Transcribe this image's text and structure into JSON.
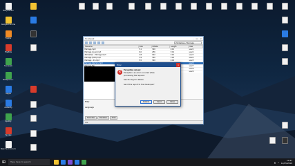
{
  "desktop": {
    "icons_col1": [
      {
        "label": "Recycle Bin",
        "icon": "recycle-bin-icon",
        "color": "#f2f2f2"
      },
      {
        "label": "Google Chrome",
        "icon": "chrome-icon",
        "color": "#f1c232"
      },
      {
        "label": "Firefox",
        "icon": "firefox-icon",
        "color": "#f08a24"
      },
      {
        "label": "FileZilla",
        "icon": "filezilla-icon",
        "color": "#d83b2b"
      },
      {
        "label": "Soulseek",
        "icon": "soulseek-icon",
        "color": "#3fa34d"
      },
      {
        "label": "Notepad++",
        "icon": "notepad-icon",
        "color": "#3fa34d"
      },
      {
        "label": "Skype",
        "icon": "skype-icon",
        "color": "#2a7be4"
      },
      {
        "label": "Audacity",
        "icon": "audacity-icon",
        "color": "#2a7be4"
      },
      {
        "label": "Spotify",
        "icon": "spotify-icon",
        "color": "#3fa34d"
      },
      {
        "label": "Yandex",
        "icon": "yandex-icon",
        "color": "#d83b2b"
      },
      {
        "label": "New Text Document",
        "icon": "document-icon",
        "color": "#f2f2f2"
      }
    ]
  },
  "app": {
    "title": "Soulseek",
    "search_value": "Zimbabwe / Marrage",
    "columns": [
      "Filename",
      "Size",
      "Bitrate",
      "Length",
      "User"
    ],
    "rows": [
      [
        "Marrage.mp3",
        "5.1",
        "320",
        "4:12",
        "user1"
      ],
      [
        "Marrage (Live).mp3",
        "6.0",
        "256",
        "5:01",
        "user2"
      ],
      [
        "Zimbabwe - Marrage.mp3",
        "4.8",
        "192",
        "4:10",
        "user3"
      ],
      [
        "Marrage (Edit).mp3",
        "3.9",
        "320",
        "3:20",
        "user4"
      ],
      [
        "Marrage - 01.mp3",
        "5.5",
        "320",
        "4:40",
        "user5"
      ],
      [
        "Marrage (Remix).mp3",
        "7.2",
        "320",
        "6:01",
        "user6"
      ],
      [
        "Marrage.flac",
        "22.4",
        "1411",
        "4:12",
        "user7"
      ],
      [
        "Marrage (Instr).mp3",
        "4.4",
        "192",
        "4:00",
        "user8"
      ],
      [
        "Marrage 2.mp3",
        "5.0",
        "256",
        "4:11",
        "user9"
      ]
    ],
    "statusbar": "Idle",
    "tabs": [
      "Searches",
      "Transfers",
      "Chat"
    ]
  },
  "dialog": {
    "title": "Error",
    "heading": "Exception raised",
    "lines": [
      "Exception: an error occurred while",
      "processing the request.",
      "",
      "See the log for details.",
      "",
      "Send this report to the developer?"
    ],
    "buttons": [
      "Details",
      "Send",
      "Close"
    ]
  },
  "taskbar": {
    "search_placeholder": "Type here to search",
    "time": "10:27",
    "date": "12/05/2019",
    "apps": [
      {
        "icon": "file-explorer-icon",
        "color": "#f1c232"
      },
      {
        "icon": "edge-icon",
        "color": "#2a7be4"
      },
      {
        "icon": "store-icon",
        "color": "#7b4fd6"
      },
      {
        "icon": "mail-icon",
        "color": "#2a7be4"
      },
      {
        "icon": "chrome-icon",
        "color": "#3fa34d"
      }
    ]
  }
}
